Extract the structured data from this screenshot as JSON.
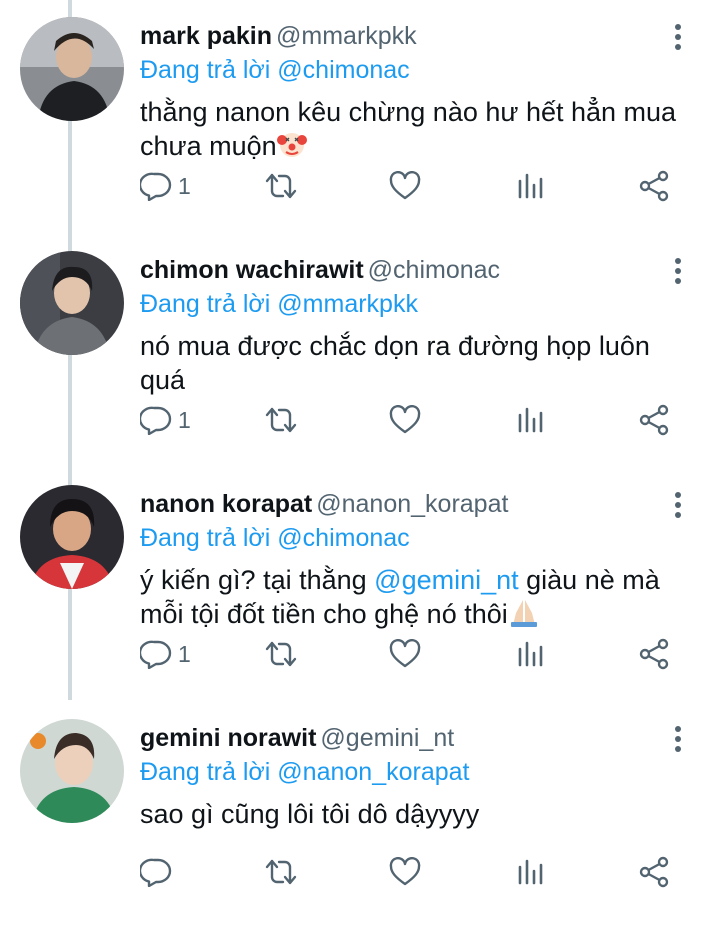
{
  "colors": {
    "link": "#1d9bf0",
    "text": "#0f1419",
    "secondary": "#536471",
    "thread_line": "#cfd9de"
  },
  "tweets": [
    {
      "name": "mark pakin",
      "handle": "@mmarkpkk",
      "reply_prefix": "Đang trả lời",
      "reply_to": "@chimonac",
      "text_before": "thằng nanon kêu chừng nào hư hết hẳn mua chưa muộn",
      "mention": "",
      "text_after": "",
      "emoji": "clown-face",
      "reply_count": "1"
    },
    {
      "name": "chimon wachirawit",
      "handle": "@chimonac",
      "reply_prefix": "Đang trả lời",
      "reply_to": "@mmarkpkk",
      "text_before": "nó mua được chắc dọn ra đường họp luôn quá",
      "mention": "",
      "text_after": "",
      "emoji": "",
      "reply_count": "1"
    },
    {
      "name": "nanon korapat",
      "handle": "@nanon_korapat",
      "reply_prefix": "Đang trả lời",
      "reply_to": "@chimonac",
      "text_before": "ý kiến gì? tại thằng ",
      "mention": "@gemini_nt",
      "text_after": " giàu nè mà mỗi tội đốt tiền cho ghệ nó thôi",
      "emoji": "folded-hands",
      "reply_count": "1"
    },
    {
      "name": "gemini norawit",
      "handle": "@gemini_nt",
      "reply_prefix": "Đang trả lời",
      "reply_to": "@nanon_korapat",
      "text_before": "sao gì cũng lôi tôi dô dậyyyy",
      "mention": "",
      "text_after": "",
      "emoji": "",
      "reply_count": ""
    }
  ]
}
